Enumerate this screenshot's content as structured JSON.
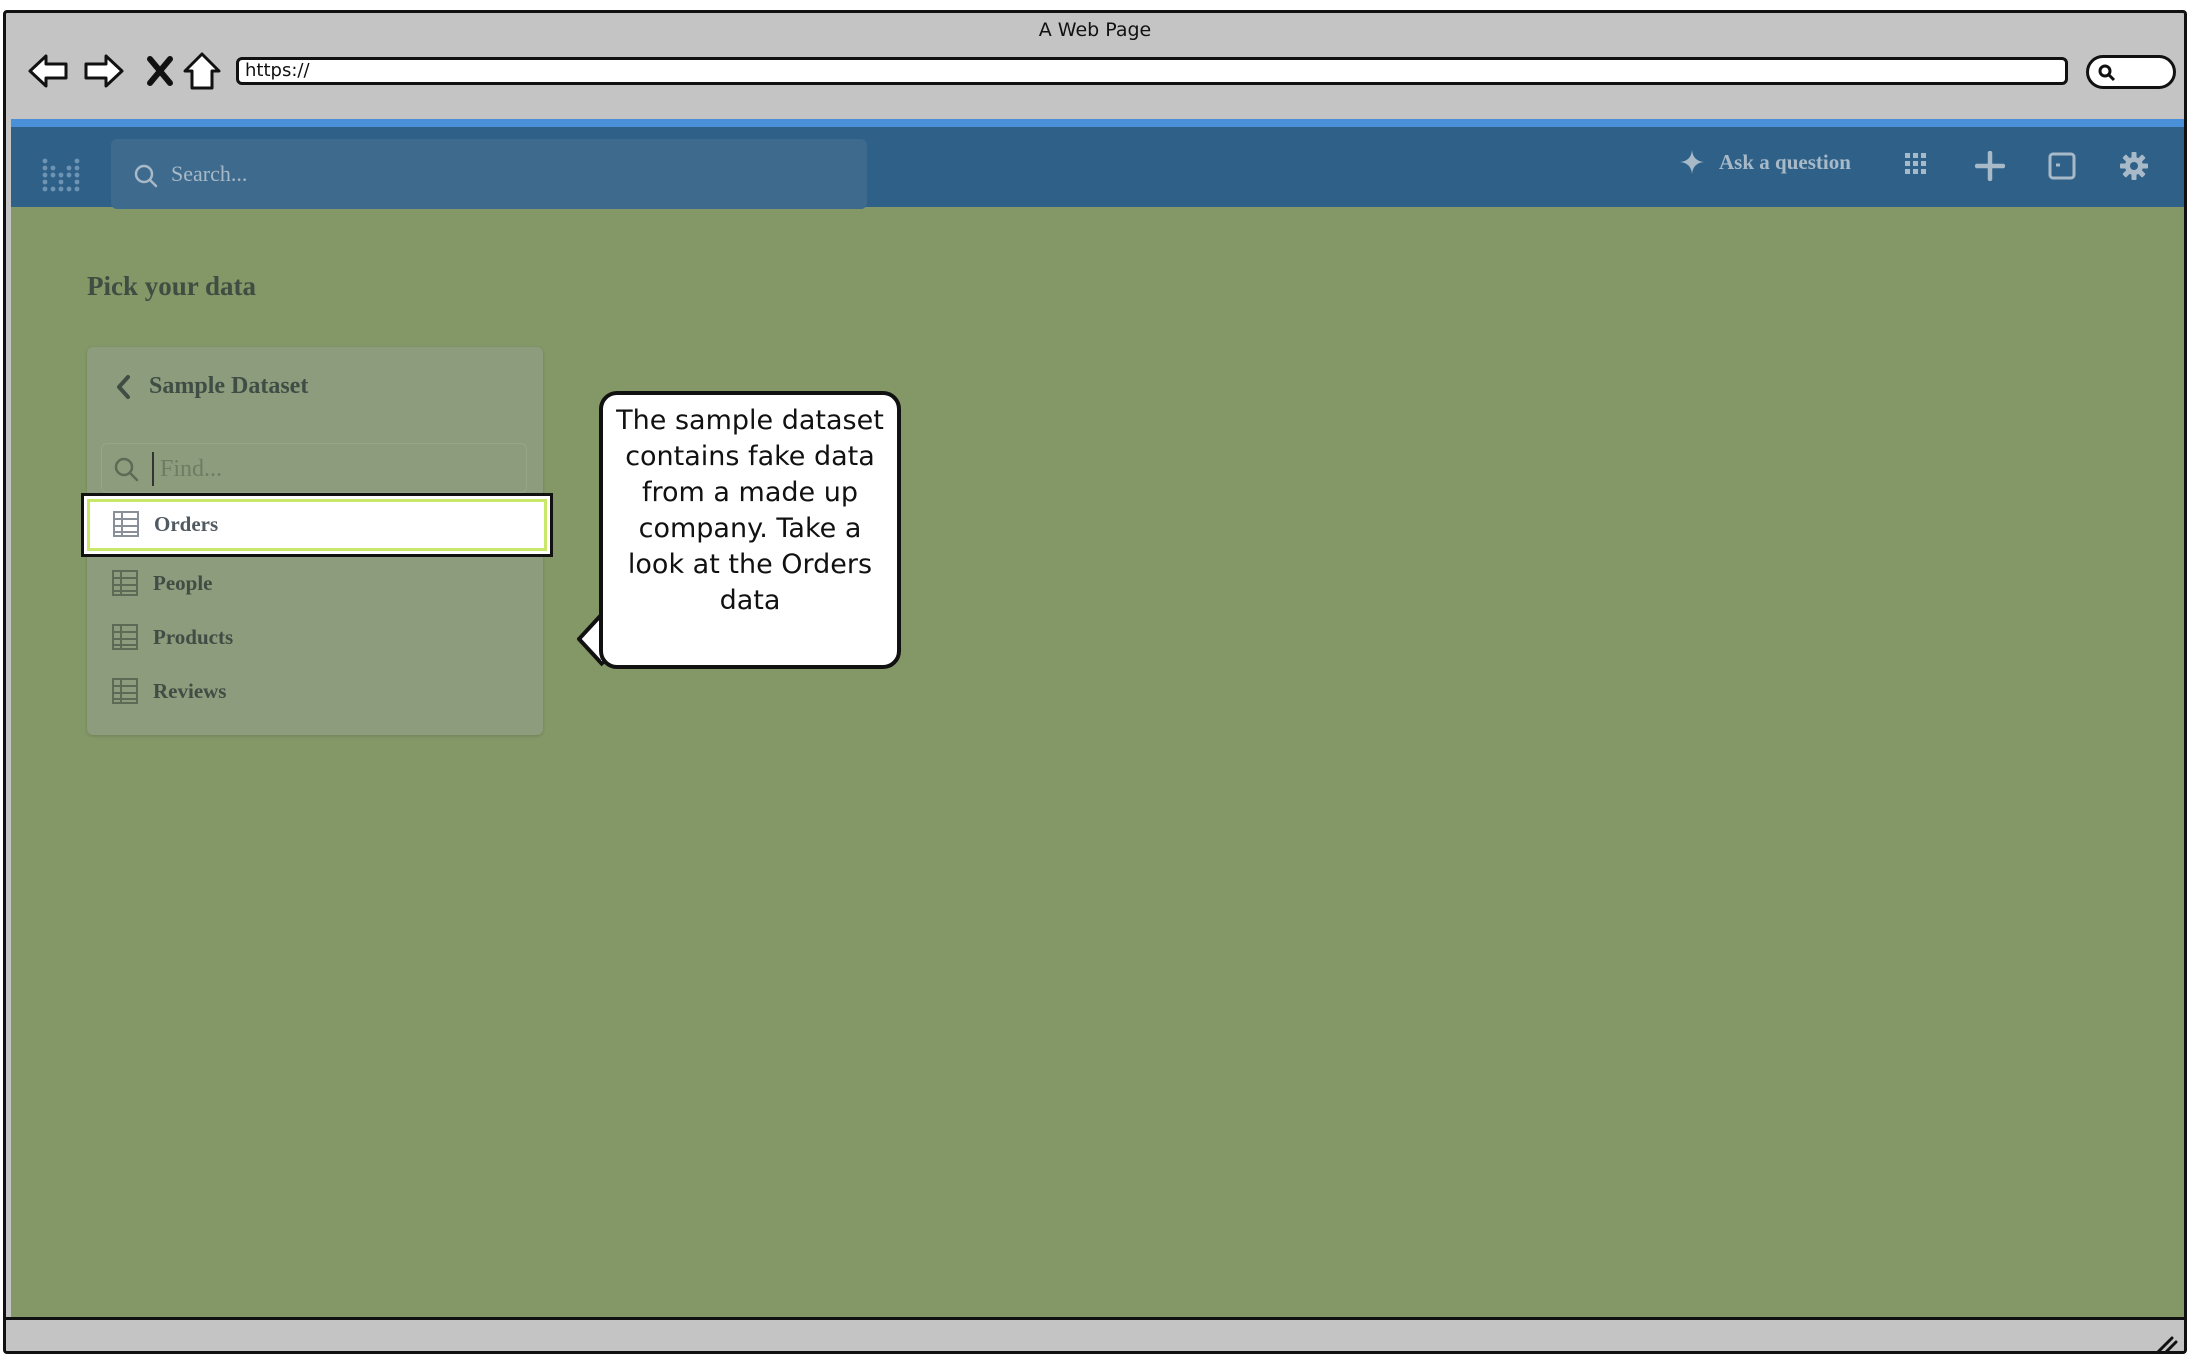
{
  "window": {
    "title": "A Web Page",
    "url": "https://"
  },
  "app": {
    "search_placeholder": "Search...",
    "ask_label": "Ask a question"
  },
  "page": {
    "heading": "Pick your data"
  },
  "picker": {
    "back_label": "Sample Dataset",
    "find_placeholder": "Find...",
    "tables": [
      {
        "label": "Orders"
      },
      {
        "label": "People"
      },
      {
        "label": "Products"
      },
      {
        "label": "Reviews"
      }
    ]
  },
  "callout": {
    "text": "The sample dataset contains fake data from a made up company. Take a look at the Orders data"
  },
  "colors": {
    "overlay": "#849767",
    "topbar": "#2f6188",
    "topbar_accent": "#4a90d8",
    "highlight_border": "#c9e86a"
  }
}
